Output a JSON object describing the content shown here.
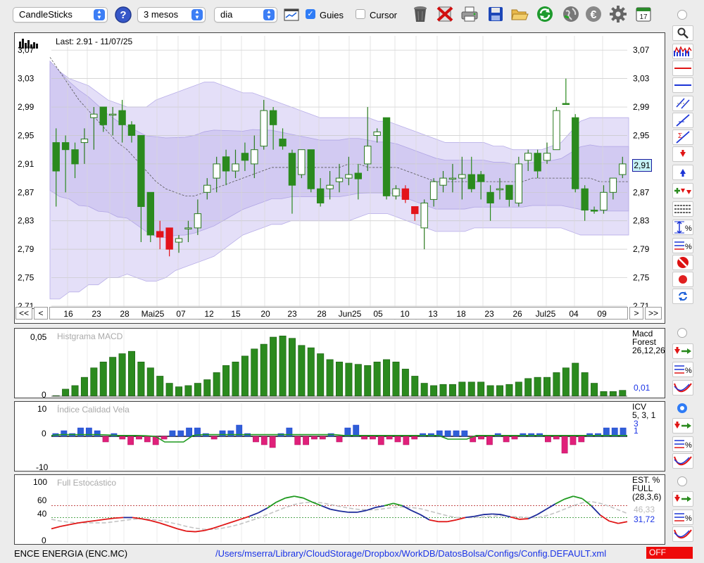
{
  "toolbar": {
    "chart_type": "CandleSticks",
    "period": "3 mesos",
    "interval": "dia",
    "guides_label": "Guies",
    "guides_checked": true,
    "cursor_label": "Cursor",
    "cursor_checked": false,
    "icons": [
      "help-icon",
      "chart-icon",
      "trash-icon",
      "delete-icon",
      "print-icon",
      "save-icon",
      "folder-icon",
      "refresh-icon",
      "globe-icon",
      "euro-icon",
      "gear-icon",
      "calendar-icon"
    ]
  },
  "main_chart": {
    "last_label": "Last: 2.91 - 11/07/25",
    "current_price": "2,91",
    "nav": {
      "first": "<<",
      "prev": "<",
      "next": ">",
      "last": ">>"
    },
    "x_labels": [
      "16",
      "23",
      "28",
      "Mai25",
      "07",
      "12",
      "15",
      "20",
      "23",
      "28",
      "Jun25",
      "05",
      "10",
      "13",
      "18",
      "23",
      "26",
      "Jul25",
      "04",
      "09"
    ]
  },
  "macd": {
    "title": "Histgrama MACD",
    "side_title": "Macd\nForest\n26,12,26",
    "value": "0,01",
    "y_top": "0,05",
    "y_bottom": "0"
  },
  "icv": {
    "title": "Índice Calidad Vela",
    "side_title": "ICV\n5, 3, 1",
    "value1": "3",
    "value2": "1",
    "y_top": "10",
    "y_mid": "0",
    "y_bottom": "-10"
  },
  "stoch": {
    "title": "Full Estocástico",
    "side_title": "EST. %\nFULL\n(28,3,6)",
    "value1": "46,33",
    "value2": "31,72",
    "y_labels": [
      "100",
      "60",
      "40",
      "0"
    ]
  },
  "status": {
    "instrument": "ENCE ENERGIA (ENC.MC)",
    "path": "/Users/mserra/Library/CloudStorage/Dropbox/WorkDB/DatosBolsa/Configs/Config.DEFAULT.xml",
    "state": "OFF"
  },
  "colors": {
    "up": "#2b8a1e",
    "down": "#e3131b",
    "band": "#d9d3f5",
    "band_inner": "#c7beef",
    "accent": "#2f7cf6",
    "blue": "#1a33e6"
  },
  "chart_data": {
    "type": "candlestick",
    "y_ticks": [
      "3,07",
      "3,03",
      "2,99",
      "2,95",
      "2,91",
      "2,87",
      "2,83",
      "2,79",
      "2,75",
      "2,71"
    ],
    "ylim": [
      2.71,
      3.09
    ],
    "candles": [
      {
        "o": 2.9,
        "c": 2.94,
        "h": 2.96,
        "l": 2.85,
        "col": "g"
      },
      {
        "o": 2.94,
        "c": 2.93,
        "h": 2.95,
        "l": 2.87,
        "col": "g"
      },
      {
        "o": 2.93,
        "c": 2.91,
        "h": 2.94,
        "l": 2.89,
        "col": "g"
      },
      {
        "o": 2.94,
        "c": 2.945,
        "h": 2.96,
        "l": 2.91,
        "col": "w"
      },
      {
        "o": 2.975,
        "c": 2.98,
        "h": 2.99,
        "l": 2.93,
        "col": "w"
      },
      {
        "o": 2.99,
        "c": 2.965,
        "h": 2.99,
        "l": 2.955,
        "col": "g"
      },
      {
        "o": 2.98,
        "c": 2.98,
        "h": 2.99,
        "l": 2.95,
        "col": "w"
      },
      {
        "o": 2.985,
        "c": 2.965,
        "h": 3.0,
        "l": 2.94,
        "col": "g"
      },
      {
        "o": 2.965,
        "c": 2.95,
        "h": 2.97,
        "l": 2.94,
        "col": "g"
      },
      {
        "o": 2.95,
        "c": 2.85,
        "h": 2.95,
        "l": 2.8,
        "col": "g"
      },
      {
        "o": 2.87,
        "c": 2.81,
        "h": 2.87,
        "l": 2.8,
        "col": "g"
      },
      {
        "o": 2.815,
        "c": 2.807,
        "h": 2.83,
        "l": 2.79,
        "col": "r"
      },
      {
        "o": 2.82,
        "c": 2.79,
        "h": 2.82,
        "l": 2.78,
        "col": "r"
      },
      {
        "o": 2.805,
        "c": 2.8,
        "h": 2.81,
        "l": 2.785,
        "col": "w"
      },
      {
        "o": 2.82,
        "c": 2.82,
        "h": 2.83,
        "l": 2.8,
        "col": "w"
      },
      {
        "o": 2.82,
        "c": 2.84,
        "h": 2.86,
        "l": 2.81,
        "col": "w"
      },
      {
        "o": 2.87,
        "c": 2.88,
        "h": 2.89,
        "l": 2.86,
        "col": "w"
      },
      {
        "o": 2.89,
        "c": 2.91,
        "h": 2.92,
        "l": 2.87,
        "col": "w"
      },
      {
        "o": 2.92,
        "c": 2.9,
        "h": 2.93,
        "l": 2.88,
        "col": "g"
      },
      {
        "o": 2.9,
        "c": 2.91,
        "h": 2.93,
        "l": 2.89,
        "col": "w"
      },
      {
        "o": 2.925,
        "c": 2.915,
        "h": 2.94,
        "l": 2.9,
        "col": "g"
      },
      {
        "o": 2.91,
        "c": 2.93,
        "h": 2.95,
        "l": 2.89,
        "col": "w"
      },
      {
        "o": 2.935,
        "c": 2.985,
        "h": 3.0,
        "l": 2.93,
        "col": "w"
      },
      {
        "o": 2.985,
        "c": 2.965,
        "h": 2.99,
        "l": 2.93,
        "col": "g"
      },
      {
        "o": 2.945,
        "c": 2.935,
        "h": 2.96,
        "l": 2.93,
        "col": "g"
      },
      {
        "o": 2.925,
        "c": 2.88,
        "h": 2.93,
        "l": 2.84,
        "col": "g"
      },
      {
        "o": 2.895,
        "c": 2.93,
        "h": 2.93,
        "l": 2.89,
        "col": "w"
      },
      {
        "o": 2.93,
        "c": 2.875,
        "h": 2.93,
        "l": 2.87,
        "col": "g"
      },
      {
        "o": 2.875,
        "c": 2.855,
        "h": 2.89,
        "l": 2.85,
        "col": "g"
      },
      {
        "o": 2.875,
        "c": 2.88,
        "h": 2.9,
        "l": 2.86,
        "col": "w"
      },
      {
        "o": 2.885,
        "c": 2.89,
        "h": 2.91,
        "l": 2.87,
        "col": "w"
      },
      {
        "o": 2.89,
        "c": 2.895,
        "h": 2.92,
        "l": 2.88,
        "col": "w"
      },
      {
        "o": 2.897,
        "c": 2.889,
        "h": 2.91,
        "l": 2.86,
        "col": "g"
      },
      {
        "o": 2.91,
        "c": 2.935,
        "h": 2.99,
        "l": 2.9,
        "col": "w"
      },
      {
        "o": 2.95,
        "c": 2.955,
        "h": 2.96,
        "l": 2.94,
        "col": "w"
      },
      {
        "o": 2.975,
        "c": 2.865,
        "h": 2.975,
        "l": 2.86,
        "col": "g"
      },
      {
        "o": 2.865,
        "c": 2.875,
        "h": 2.88,
        "l": 2.86,
        "col": "w"
      },
      {
        "o": 2.875,
        "c": 2.86,
        "h": 2.88,
        "l": 2.855,
        "col": "r"
      },
      {
        "o": 2.85,
        "c": 2.84,
        "h": 2.85,
        "l": 2.83,
        "col": "r"
      },
      {
        "o": 2.82,
        "c": 2.855,
        "h": 2.86,
        "l": 2.79,
        "col": "w"
      },
      {
        "o": 2.86,
        "c": 2.885,
        "h": 2.89,
        "l": 2.85,
        "col": "w"
      },
      {
        "o": 2.88,
        "c": 2.89,
        "h": 2.9,
        "l": 2.87,
        "col": "w"
      },
      {
        "o": 2.89,
        "c": 2.89,
        "h": 2.91,
        "l": 2.87,
        "col": "w"
      },
      {
        "o": 2.89,
        "c": 2.895,
        "h": 2.92,
        "l": 2.86,
        "col": "w"
      },
      {
        "o": 2.895,
        "c": 2.875,
        "h": 2.92,
        "l": 2.87,
        "col": "g"
      },
      {
        "o": 2.895,
        "c": 2.885,
        "h": 2.9,
        "l": 2.86,
        "col": "g"
      },
      {
        "o": 2.87,
        "c": 2.855,
        "h": 2.88,
        "l": 2.83,
        "col": "g"
      },
      {
        "o": 2.875,
        "c": 2.875,
        "h": 2.89,
        "l": 2.86,
        "col": "w"
      },
      {
        "o": 2.88,
        "c": 2.86,
        "h": 2.88,
        "l": 2.85,
        "col": "g"
      },
      {
        "o": 2.855,
        "c": 2.91,
        "h": 2.92,
        "l": 2.85,
        "col": "w"
      },
      {
        "o": 2.915,
        "c": 2.925,
        "h": 2.93,
        "l": 2.9,
        "col": "w"
      },
      {
        "o": 2.925,
        "c": 2.9,
        "h": 2.93,
        "l": 2.89,
        "col": "g"
      },
      {
        "o": 2.915,
        "c": 2.925,
        "h": 2.94,
        "l": 2.91,
        "col": "w"
      },
      {
        "o": 2.93,
        "c": 2.985,
        "h": 2.99,
        "l": 2.93,
        "col": "w"
      },
      {
        "o": 2.995,
        "c": 2.995,
        "h": 3.03,
        "l": 2.995,
        "col": "g"
      },
      {
        "o": 2.975,
        "c": 2.875,
        "h": 2.98,
        "l": 2.87,
        "col": "g"
      },
      {
        "o": 2.875,
        "c": 2.845,
        "h": 2.88,
        "l": 2.83,
        "col": "g"
      },
      {
        "o": 2.845,
        "c": 2.845,
        "h": 2.85,
        "l": 2.84,
        "col": "g"
      },
      {
        "o": 2.845,
        "c": 2.87,
        "h": 2.88,
        "l": 2.84,
        "col": "w"
      },
      {
        "o": 2.87,
        "c": 2.89,
        "h": 2.89,
        "l": 2.86,
        "col": "w"
      },
      {
        "o": 2.895,
        "c": 2.91,
        "h": 2.92,
        "l": 2.89,
        "col": "w"
      }
    ],
    "band_upper": [
      3.05,
      3.04,
      3.03,
      3.025,
      3.02,
      3.01,
      3.0,
      2.995,
      2.99,
      2.99,
      2.99,
      3.0,
      3.005,
      3.01,
      3.015,
      3.02,
      3.025,
      3.025,
      3.02,
      3.015,
      3.01,
      3.01,
      3.005,
      3.0,
      2.995,
      2.99,
      2.985,
      2.98,
      2.975,
      2.975,
      2.975,
      2.975,
      2.975,
      2.975,
      2.97,
      2.97,
      2.965,
      2.96,
      2.955,
      2.95,
      2.945,
      2.94,
      2.94,
      2.94,
      2.94,
      2.94,
      2.935,
      2.935,
      2.93,
      2.93,
      2.93,
      2.93,
      2.935,
      2.94,
      2.955,
      2.97,
      2.975,
      2.975,
      2.975,
      2.975,
      2.975
    ],
    "band_lower": [
      2.72,
      2.72,
      2.73,
      2.73,
      2.74,
      2.74,
      2.75,
      2.75,
      2.755,
      2.75,
      2.745,
      2.745,
      2.75,
      2.76,
      2.765,
      2.77,
      2.775,
      2.78,
      2.79,
      2.8,
      2.81,
      2.815,
      2.82,
      2.825,
      2.825,
      2.83,
      2.83,
      2.83,
      2.83,
      2.83,
      2.83,
      2.83,
      2.835,
      2.84,
      2.84,
      2.84,
      2.835,
      2.83,
      2.825,
      2.82,
      2.815,
      2.815,
      2.815,
      2.815,
      2.82,
      2.82,
      2.82,
      2.82,
      2.82,
      2.82,
      2.82,
      2.82,
      2.82,
      2.82,
      2.815,
      2.81,
      2.81,
      2.81,
      2.81,
      2.81,
      2.81
    ],
    "ma": [
      3.06,
      3.04,
      3.02,
      3.0,
      2.985,
      2.97,
      2.955,
      2.94,
      2.93,
      2.915,
      2.9,
      2.885,
      2.875,
      2.87,
      2.865,
      2.865,
      2.87,
      2.875,
      2.88,
      2.885,
      2.89,
      2.895,
      2.9,
      2.905,
      2.905,
      2.905,
      2.905,
      2.905,
      2.905,
      2.905,
      2.905,
      2.91,
      2.91,
      2.905,
      2.905,
      2.905,
      2.905,
      2.9,
      2.895,
      2.89,
      2.885,
      2.885,
      2.885,
      2.885,
      2.885,
      2.885,
      2.885,
      2.885,
      2.885,
      2.885,
      2.89,
      2.89,
      2.89,
      2.89,
      2.89,
      2.89,
      2.89,
      2.885,
      2.885,
      2.885,
      2.885
    ],
    "macd_hist": [
      0.0005,
      0.006,
      0.009,
      0.016,
      0.024,
      0.029,
      0.033,
      0.036,
      0.038,
      0.029,
      0.024,
      0.017,
      0.011,
      0.008,
      0.009,
      0.011,
      0.014,
      0.02,
      0.026,
      0.029,
      0.034,
      0.04,
      0.044,
      0.05,
      0.051,
      0.049,
      0.043,
      0.041,
      0.036,
      0.031,
      0.029,
      0.028,
      0.027,
      0.026,
      0.029,
      0.031,
      0.029,
      0.023,
      0.017,
      0.011,
      0.009,
      0.01,
      0.01,
      0.012,
      0.012,
      0.012,
      0.009,
      0.009,
      0.01,
      0.012,
      0.015,
      0.016,
      0.016,
      0.02,
      0.024,
      0.028,
      0.02,
      0.011,
      0.004,
      0.004,
      0.005
    ],
    "icv_bars": [
      1,
      2,
      1,
      3,
      3,
      2,
      -2,
      1,
      -1,
      -3,
      -1,
      -2,
      -3,
      -1,
      2,
      2,
      3,
      3,
      1,
      -1,
      2,
      2,
      4,
      1,
      -2,
      -3,
      -4,
      1,
      3,
      -3,
      -3,
      -1,
      -1,
      1,
      -2,
      3,
      4,
      -1,
      -1,
      -3,
      -1,
      -2,
      -3,
      -1,
      1,
      1,
      2,
      2,
      2,
      2,
      -2,
      -1,
      -3,
      1,
      -2,
      -1,
      1,
      1,
      1,
      -2,
      -1,
      -6,
      -3,
      -2,
      1,
      1,
      3,
      3,
      3
    ],
    "icv_line": [
      0.3,
      0.6,
      0.6,
      0.6,
      0.6,
      0.6,
      0.5,
      0.3,
      0.3,
      0.3,
      0.2,
      0,
      -2,
      -2,
      -2,
      0.3,
      0.6,
      0.6,
      0.6,
      0.6,
      0.6,
      0.6,
      0.6,
      0.6,
      0.6,
      0.6,
      0.6,
      0.6,
      0.6,
      0.6,
      0.6,
      0.3,
      0.3,
      0.3,
      0.3,
      0.3,
      0.3,
      0.3,
      0.3,
      0.3,
      0.3,
      0.3,
      -1,
      -1,
      -1,
      0.3,
      0.3,
      0.3,
      0.3,
      0.3,
      0.3,
      0.3,
      0.3,
      0.3,
      0.3,
      0.3,
      0.3,
      0.3,
      0.3,
      0.3,
      0.3,
      0.3
    ],
    "stoch_k": [
      21,
      25,
      28,
      31,
      33,
      35,
      37,
      39,
      40,
      40,
      38,
      35,
      31,
      26,
      21,
      17,
      16,
      18,
      22,
      27,
      32,
      37,
      42,
      48,
      56,
      66,
      73,
      76,
      73,
      66,
      60,
      54,
      51,
      49,
      49,
      52,
      57,
      60,
      64,
      60,
      52,
      45,
      36,
      33,
      33,
      36,
      40,
      42,
      45,
      46,
      45,
      41,
      37,
      38,
      45,
      54,
      63,
      71,
      76,
      72,
      60,
      44,
      34,
      30,
      33
    ],
    "stoch_d": [
      37,
      34,
      32,
      31,
      31,
      31,
      31,
      33,
      35,
      37,
      38,
      37,
      35,
      32,
      29,
      25,
      22,
      20,
      20,
      22,
      25,
      29,
      34,
      39,
      45,
      51,
      57,
      62,
      65,
      66,
      65,
      62,
      59,
      56,
      54,
      53,
      53,
      55,
      57,
      58,
      57,
      55,
      51,
      47,
      43,
      40,
      40,
      40,
      41,
      42,
      43,
      42,
      41,
      40,
      40,
      43,
      48,
      54,
      60,
      65,
      67,
      64,
      59,
      53,
      47
    ]
  }
}
